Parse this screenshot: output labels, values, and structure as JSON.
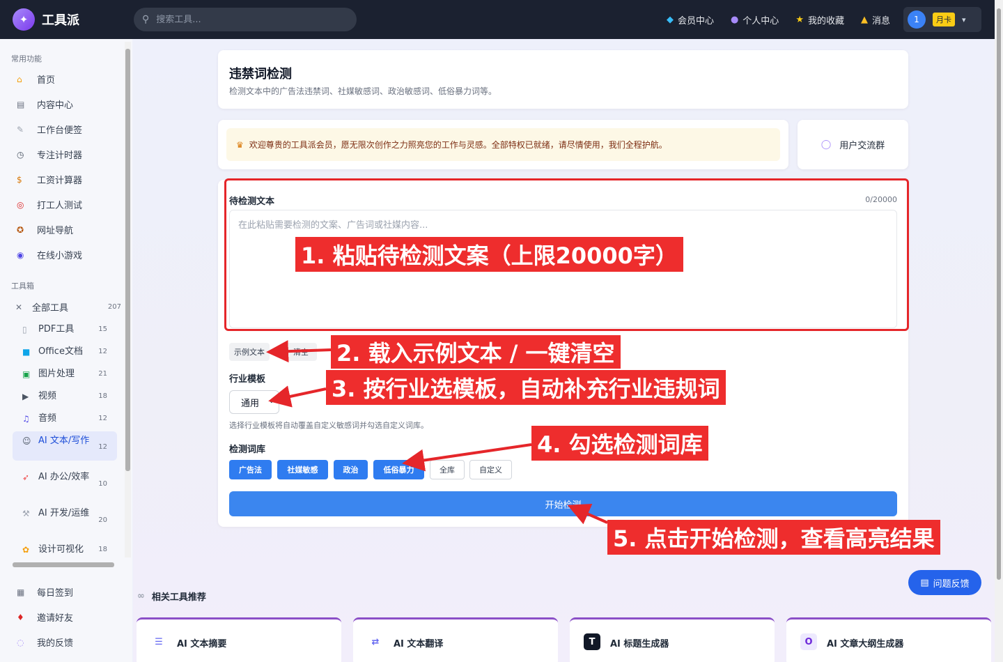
{
  "app": {
    "name": "工具派",
    "logo_icon": "magic-bag-icon"
  },
  "search": {
    "placeholder": "搜索工具..."
  },
  "nav": {
    "items": [
      {
        "label": "会员中心",
        "icon": "diamond-icon"
      },
      {
        "label": "个人中心",
        "icon": "person-icon"
      },
      {
        "label": "我的收藏",
        "icon": "star-icon"
      },
      {
        "label": "消息",
        "icon": "bell-icon"
      }
    ],
    "user": {
      "avatar_text": "1",
      "badge": "月卡"
    }
  },
  "sidebar": {
    "common_title": "常用功能",
    "common_items": [
      {
        "label": "首页",
        "icon": "home-icon"
      },
      {
        "label": "内容中心",
        "icon": "newspaper-icon"
      },
      {
        "label": "工作台便签",
        "icon": "memo-icon"
      },
      {
        "label": "专注计时器",
        "icon": "stopwatch-icon"
      },
      {
        "label": "工资计算器",
        "icon": "money-bag-icon"
      },
      {
        "label": "打工人测试",
        "icon": "target-icon"
      },
      {
        "label": "网址导航",
        "icon": "compass-icon"
      },
      {
        "label": "在线小游戏",
        "icon": "gamepad-icon"
      }
    ],
    "toolbox_title": "工具箱",
    "all_tools": {
      "label": "全部工具",
      "count": "207",
      "icon": "tools-icon"
    },
    "tools": [
      {
        "label": "PDF工具",
        "count": "15",
        "icon": "pdf-icon"
      },
      {
        "label": "Office文档",
        "count": "12",
        "icon": "office-icon"
      },
      {
        "label": "图片处理",
        "count": "21",
        "icon": "image-icon"
      },
      {
        "label": "视频",
        "count": "18",
        "icon": "video-icon"
      },
      {
        "label": "音频",
        "count": "12",
        "icon": "music-icon"
      },
      {
        "label": "AI 文本/写作",
        "count": "12",
        "icon": "robot-icon"
      },
      {
        "label": "AI 办公/效率",
        "count": "10",
        "icon": "rocket-icon"
      },
      {
        "label": "AI 开发/运维",
        "count": "20",
        "icon": "wrench-icon"
      },
      {
        "label": "设计可视化",
        "count": "18",
        "icon": "palette-icon"
      }
    ],
    "bottom_items": [
      {
        "label": "每日签到",
        "icon": "calendar-icon"
      },
      {
        "label": "邀请好友",
        "icon": "gift-icon"
      },
      {
        "label": "我的反馈",
        "icon": "speech-bubble-icon"
      }
    ]
  },
  "page": {
    "title": "违禁词检测",
    "subtitle": "检测文本中的广告法违禁词、社媒敏感词、政治敏感词、低俗暴力词等。"
  },
  "welcome": {
    "text": "欢迎尊贵的工具派会员，愿无限次创作之力照亮您的工作与灵感。全部特权已就绪，请尽情使用，我们全程护航。",
    "icon": "crown-icon"
  },
  "group": {
    "label": "用户交流群",
    "icon": "chat-bubble-icon"
  },
  "form": {
    "text_label": "待检测文本",
    "counter": "0/20000",
    "textarea_placeholder": "在此粘贴需要检测的文案、广告词或社媒内容...",
    "sample_btn": "示例文本",
    "clear_btn": "清空",
    "industry_label": "行业模板",
    "industry_value": "通用",
    "industry_hint": "选择行业模板将自动覆盖自定义敏感词并勾选自定义词库。",
    "lib_label": "检测词库",
    "libs": [
      {
        "label": "广告法",
        "selected": true
      },
      {
        "label": "社媒敏感",
        "selected": true
      },
      {
        "label": "政治",
        "selected": true
      },
      {
        "label": "低俗暴力",
        "selected": true
      },
      {
        "label": "全库",
        "selected": false
      },
      {
        "label": "自定义",
        "selected": false
      }
    ],
    "start_btn": "开始检测"
  },
  "annotations": [
    "1. 粘贴待检测文案（上限20000字）",
    "2. 载入示例文本 / 一键清空",
    "3. 按行业选模板，自动补充行业违规词",
    "4. 勾选检测词库",
    "5. 点击开始检测，查看高亮结果"
  ],
  "related": {
    "title": "相关工具推荐",
    "icon": "link-icon",
    "items": [
      {
        "label": "AI 文本摘要",
        "icon": "list-lines-icon"
      },
      {
        "label": "AI 文本翻译",
        "icon": "translate-icon"
      },
      {
        "label": "AI 标题生成器",
        "icon": "title-t-icon"
      },
      {
        "label": "AI 文章大纲生成器",
        "icon": "outline-o-icon"
      }
    ]
  },
  "feedback": {
    "label": "问题反馈",
    "icon": "document-icon"
  },
  "colors": {
    "topbar": "#1b2130",
    "primary": "#3b86ef",
    "chip": "#2f7cf0",
    "annotation": "#ee2d2d",
    "related_accent": "#8b4fc7",
    "welcome_bg": "#fdf8e6"
  }
}
